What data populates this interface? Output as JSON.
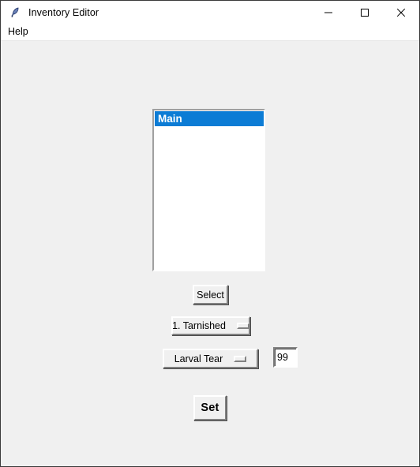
{
  "window": {
    "title": "Inventory Editor",
    "icon": "feather-icon",
    "background_color": "#f0f0f0",
    "controls": {
      "minimize": "minimize-icon",
      "maximize": "maximize-icon",
      "close": "close-icon"
    }
  },
  "menubar": {
    "items": [
      {
        "label": "Help"
      }
    ]
  },
  "listbox": {
    "selection_color": "#0c7cd5",
    "items": [
      {
        "label": "Main",
        "selected": true
      }
    ]
  },
  "buttons": {
    "select_label": "Select",
    "set_label": "Set"
  },
  "option_menus": [
    {
      "name": "slot-select",
      "value": "1. Tarnished",
      "indicator": "tk-option-indicator"
    },
    {
      "name": "item-select",
      "value": "Larval Tear",
      "indicator": "tk-option-indicator"
    }
  ],
  "quantity_entry": {
    "value": "99",
    "placeholder": ""
  }
}
